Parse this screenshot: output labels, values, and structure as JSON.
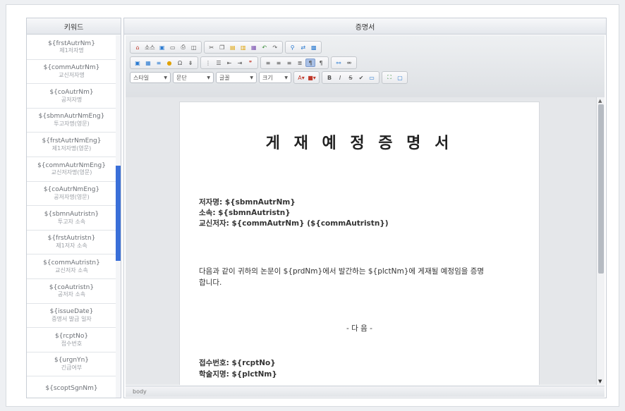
{
  "keyword_panel": {
    "title": "키워드",
    "items": [
      {
        "code": "${frstAutrNm}",
        "desc": "제1저자명"
      },
      {
        "code": "${commAutrNm}",
        "desc": "교신저자명"
      },
      {
        "code": "${coAutrNm}",
        "desc": "공저자명"
      },
      {
        "code": "${sbmnAutrNmEng}",
        "desc": "투고자명(영문)"
      },
      {
        "code": "${frstAutrNmEng}",
        "desc": "제1저자명(영문)"
      },
      {
        "code": "${commAutrNmEng}",
        "desc": "교신저자명(영문)"
      },
      {
        "code": "${coAutrNmEng}",
        "desc": "공저자명(영문)"
      },
      {
        "code": "${sbmnAutristn}",
        "desc": "투고자 소속"
      },
      {
        "code": "${frstAutristn}",
        "desc": "제1저자 소속"
      },
      {
        "code": "${commAutristn}",
        "desc": "교신저자 소속"
      },
      {
        "code": "${coAutristn}",
        "desc": "공저자 소속"
      },
      {
        "code": "${issueDate}",
        "desc": "증명서 발급 일자"
      },
      {
        "code": "${rcptNo}",
        "desc": "접수번호"
      },
      {
        "code": "${urgnYn}",
        "desc": "긴급여부"
      },
      {
        "code": "${scoptSgnNm}",
        "desc": ""
      }
    ]
  },
  "editor_panel": {
    "title": "증명서",
    "toolbar": {
      "source_label": "소스",
      "style_combo": "스타일",
      "format_combo": "문단",
      "font_combo": "글꼴",
      "size_combo": "크기"
    },
    "document": {
      "title": "게 재 예 정 증 명 서",
      "author_line": "저자명: ${sbmnAutrNm}",
      "affiliation_line": "소속: ${sbmnAutristn}",
      "corresponding_line": "교신저자: ${commAutrNm} (${commAutristn})",
      "body_line1": "다음과 같이 귀하의 논문이 ${prdNm}에서 발간하는 ${plctNm}에 게재될 예정임을 증명",
      "body_line2": "합니다.",
      "center_label": "- 다 음 -",
      "receipt_line": "접수번호: ${rcptNo}",
      "journal_line": "학술지명: ${plctNm}"
    },
    "status_text": "body"
  },
  "colors": {
    "accent_scroll": "#3a6fd8",
    "active_button": "#a9c0e6"
  }
}
